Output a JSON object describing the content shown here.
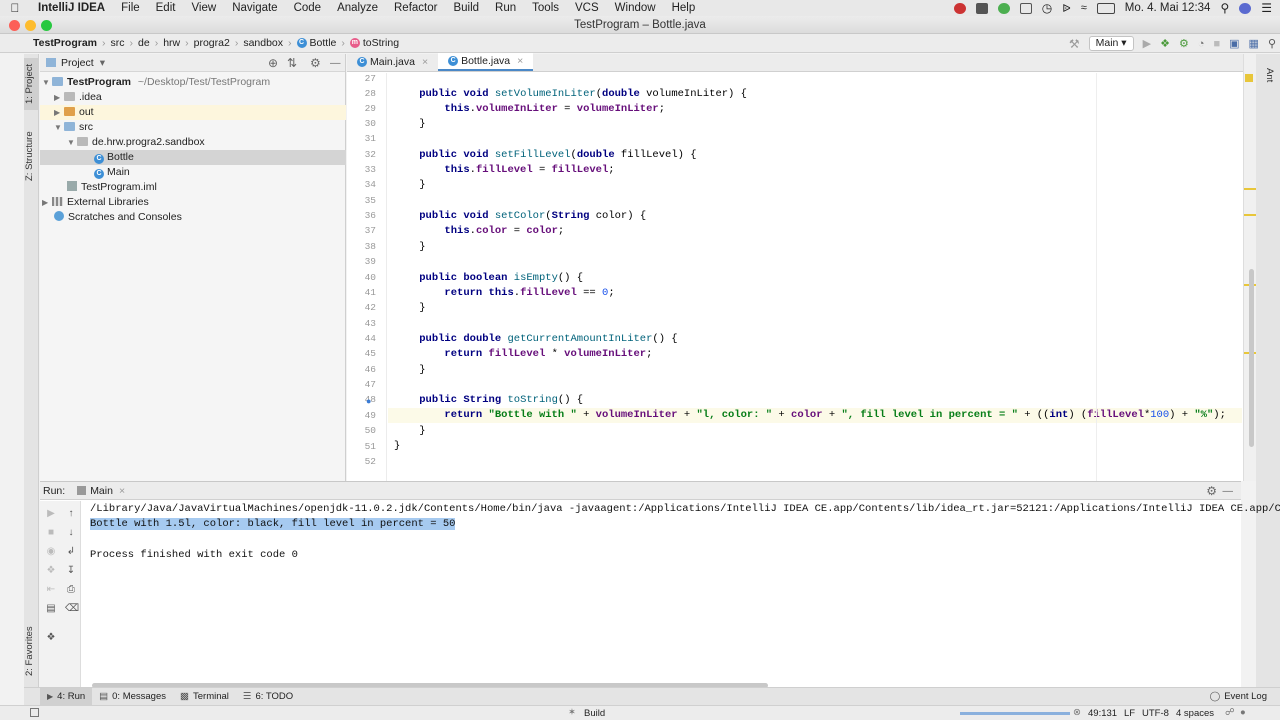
{
  "menubar": {
    "app_name": "IntelliJ IDEA",
    "items": [
      "File",
      "Edit",
      "View",
      "Navigate",
      "Code",
      "Analyze",
      "Refactor",
      "Build",
      "Run",
      "Tools",
      "VCS",
      "Window",
      "Help"
    ],
    "clock": "Mo. 4. Mai  12:34"
  },
  "window": {
    "title": "TestProgram – Bottle.java"
  },
  "breadcrumb": {
    "items": [
      "TestProgram",
      "src",
      "de",
      "hrw",
      "progra2",
      "sandbox",
      "Bottle",
      "toString"
    ],
    "run_config": "Main"
  },
  "project_panel": {
    "title": "Project",
    "tree": [
      {
        "label": "TestProgram",
        "suffix": "~/Desktop/Test/TestProgram"
      },
      {
        "label": ".idea"
      },
      {
        "label": "out"
      },
      {
        "label": "src"
      },
      {
        "label": "de.hrw.progra2.sandbox"
      },
      {
        "label": "Bottle"
      },
      {
        "label": "Main"
      },
      {
        "label": "TestProgram.iml"
      },
      {
        "label": "External Libraries"
      },
      {
        "label": "Scratches and Consoles"
      }
    ]
  },
  "left_tabs": {
    "project": "1: Project",
    "structure": "Z: Structure",
    "favorites": "2: Favorites"
  },
  "right_tabs": {
    "ant": "Ant"
  },
  "editor": {
    "tabs": [
      "Main.java",
      "Bottle.java"
    ],
    "line_numbers": [
      "27",
      "28",
      "29",
      "30",
      "31",
      "32",
      "33",
      "34",
      "35",
      "36",
      "37",
      "38",
      "39",
      "40",
      "41",
      "42",
      "43",
      "44",
      "45",
      "46",
      "47",
      "48",
      "49",
      "50",
      "51",
      "52"
    ],
    "lines": [
      "",
      "    public void setVolumeInLiter(double volumeInLiter) {",
      "        this.volumeInLiter = volumeInLiter;",
      "    }",
      "",
      "    public void setFillLevel(double fillLevel) {",
      "        this.fillLevel = fillLevel;",
      "    }",
      "",
      "    public void setColor(String color) {",
      "        this.color = color;",
      "    }",
      "",
      "    public boolean isEmpty() {",
      "        return this.fillLevel == 0;",
      "    }",
      "",
      "    public double getCurrentAmountInLiter() {",
      "        return fillLevel * volumeInLiter;",
      "    }",
      "",
      "    public String toString() {",
      "        return \"Bottle with \" + volumeInLiter + \"l, color: \" + color + \", fill level in percent = \" + ((int) (fillLevel*100) + \"%\");",
      "    }",
      "}",
      ""
    ]
  },
  "run_panel": {
    "label": "Run:",
    "tab": "Main",
    "output": [
      "/Library/Java/JavaVirtualMachines/openjdk-11.0.2.jdk/Contents/Home/bin/java -javaagent:/Applications/IntelliJ IDEA CE.app/Contents/lib/idea_rt.jar=52121:/Applications/IntelliJ IDEA CE.app/Conten",
      "Bottle with 1.5l, color: black, fill level in percent = 50",
      "",
      "Process finished with exit code 0"
    ]
  },
  "bottom_tabs": [
    "4: Run",
    "0: Messages",
    "Terminal",
    "6: TODO"
  ],
  "event_log": "Event Log",
  "status": {
    "build": "Build",
    "position": "49:131",
    "line_sep": "LF",
    "encoding": "UTF-8",
    "indent": "4 spaces"
  },
  "colors": {
    "accent": "#4a88c7",
    "selection": "#a6caf0",
    "keyword": "#000080",
    "string": "#067d17"
  }
}
